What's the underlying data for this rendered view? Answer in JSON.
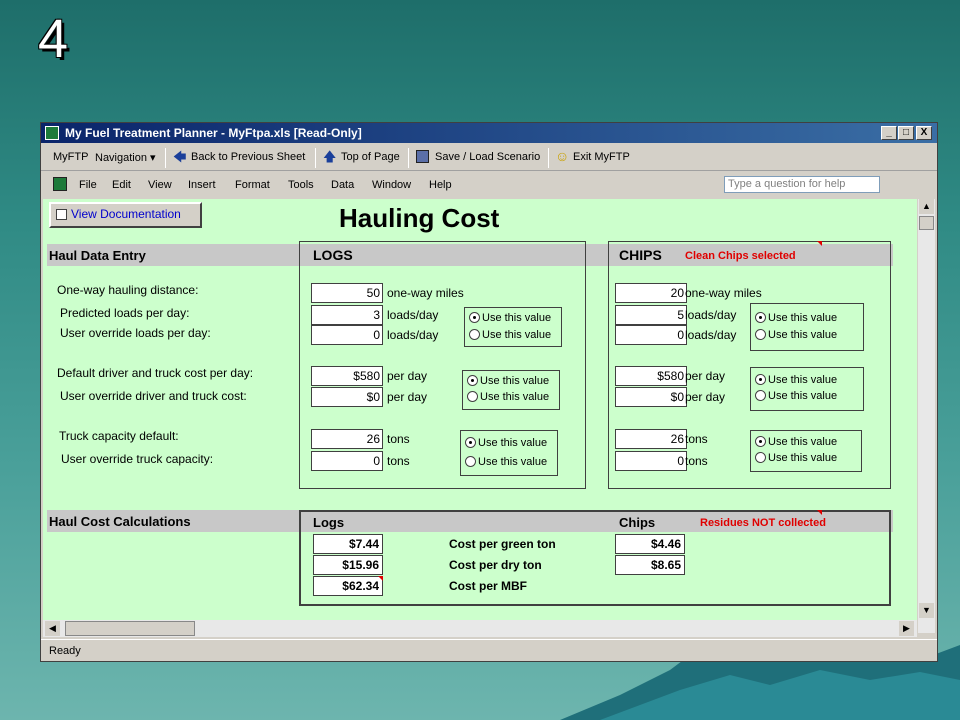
{
  "slide": {
    "number": "4"
  },
  "window": {
    "title": "My Fuel Treatment Planner - MyFtpa.xls  [Read-Only]",
    "controls": {
      "minimize": "_",
      "maximize": "□",
      "close": "X"
    }
  },
  "toolbar": {
    "myftp": "MyFTP",
    "navigation": "Navigation ▾",
    "back": "Back to Previous Sheet",
    "top": "Top of Page",
    "save": "Save / Load Scenario",
    "exit": "Exit MyFTP"
  },
  "menu": {
    "items": [
      "File",
      "Edit",
      "View",
      "Insert",
      "Format",
      "Tools",
      "Data",
      "Window",
      "Help"
    ],
    "question_placeholder": "Type a question for help"
  },
  "sheet": {
    "view_doc": "View Documentation",
    "title": "Hauling Cost",
    "entry_label": "Haul Data Entry",
    "calc_label": "Haul Cost Calculations",
    "labels": {
      "one_way": "One-way hauling distance:",
      "pred_loads": "Predicted loads per day:",
      "override_loads": "User override loads per day:",
      "default_cost": "Default driver and truck cost per day:",
      "override_cost": "User override driver and truck cost:",
      "capacity_default": "Truck capacity default:",
      "override_capacity": "User override truck capacity:"
    },
    "radio": {
      "use": "Use this value"
    },
    "logs": {
      "heading": "LOGS",
      "distance": "50",
      "distance_unit": "one-way miles",
      "pred_loads": "3",
      "override_loads": "0",
      "loads_unit": "loads/day",
      "cost": "$580",
      "override_cost": "$0",
      "cost_unit": "per day",
      "capacity": "26",
      "override_capacity": "0",
      "capacity_unit": "tons"
    },
    "chips": {
      "heading": "CHIPS",
      "note": "Clean Chips selected",
      "distance": "20",
      "distance_unit": "one-way miles",
      "pred_loads": "5",
      "override_loads": "0",
      "loads_unit": "loads/day",
      "cost": "$580",
      "override_cost": "$0",
      "cost_unit": "per day",
      "capacity": "26",
      "override_capacity": "0",
      "capacity_unit": "tons"
    },
    "calc": {
      "logs_heading": "Logs",
      "chips_heading": "Chips",
      "residues_note": "Residues NOT collected",
      "rows": [
        {
          "label": "Cost per green ton",
          "logs": "$7.44",
          "chips": "$4.46"
        },
        {
          "label": "Cost per dry ton",
          "logs": "$15.96",
          "chips": "$8.65"
        },
        {
          "label": "Cost per MBF",
          "logs": "$62.34",
          "chips": ""
        }
      ]
    }
  },
  "status": {
    "text": "Ready"
  },
  "colors": {
    "sheet_bg": "#ccffcc",
    "band": "#c8c8c8",
    "note_red": "#e00000",
    "titlebar": "#0a246a"
  }
}
